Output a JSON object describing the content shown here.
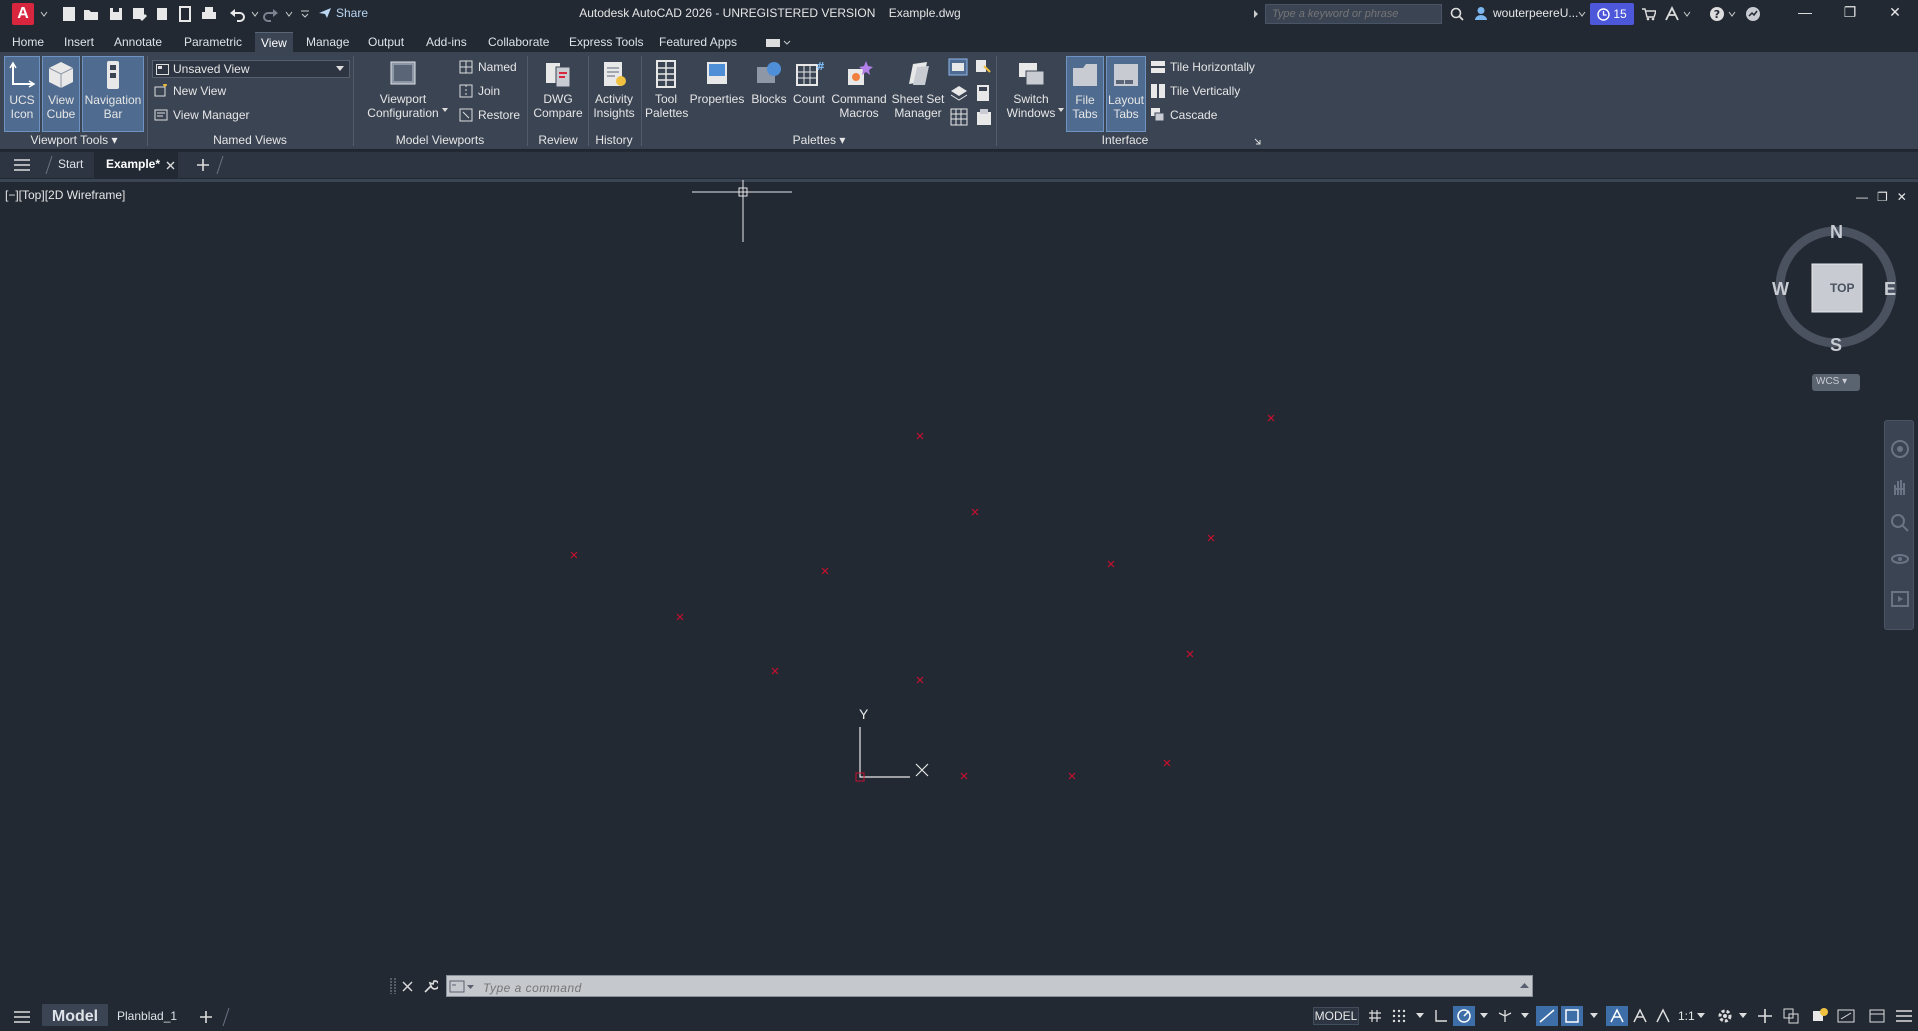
{
  "app": {
    "logo_letter": "A",
    "title": "Autodesk AutoCAD 2026 - UNREGISTERED VERSION    Example.dwg",
    "share_label": "Share",
    "search_placeholder": "Type a keyword or phrase",
    "user": "wouterpeereU...",
    "notification_count": "15"
  },
  "ribbon_tabs": [
    "Home",
    "Insert",
    "Annotate",
    "Parametric",
    "View",
    "Manage",
    "Output",
    "Add-ins",
    "Collaborate",
    "Express Tools",
    "Featured Apps"
  ],
  "active_tab": "View",
  "ribbon": {
    "viewport_tools": {
      "title": "Viewport Tools",
      "ucs_icon": "UCS Icon",
      "view_cube": "View Cube",
      "navigation_bar": "Navigation Bar"
    },
    "named_views": {
      "title": "Named Views",
      "combo_value": "Unsaved View",
      "new_view": "New View",
      "view_manager": "View Manager"
    },
    "model_viewports": {
      "title": "Model Viewports",
      "viewport_configuration": "Viewport Configuration",
      "named": "Named",
      "join": "Join",
      "restore": "Restore"
    },
    "review": {
      "title": "Review",
      "dwg_compare": "DWG Compare"
    },
    "history": {
      "title": "History",
      "activity_insights": "Activity Insights"
    },
    "palettes": {
      "title": "Palettes",
      "tool_palettes": "Tool Palettes",
      "properties": "Properties",
      "blocks": "Blocks",
      "count": "Count",
      "command_macros": "Command Macros",
      "sheet_set_manager": "Sheet Set Manager"
    },
    "interface": {
      "title": "Interface",
      "switch_windows": "Switch Windows",
      "file_tabs": "File Tabs",
      "layout_tabs": "Layout Tabs",
      "tile_horizontally": "Tile Horizontally",
      "tile_vertically": "Tile Vertically",
      "cascade": "Cascade"
    }
  },
  "file_tabs": {
    "start": "Start",
    "active": "Example*"
  },
  "viewport": {
    "label": "[−][Top][2D Wireframe]",
    "compass": {
      "n": "N",
      "s": "S",
      "e": "E",
      "w": "W",
      "face": "TOP"
    },
    "wcs": "WCS",
    "ucs_x": "X",
    "ucs_y": "Y"
  },
  "command_line": {
    "placeholder": "Type a command"
  },
  "layout_tabs": {
    "model": "Model",
    "layout1": "Planblad_1"
  },
  "status": {
    "model_space": "MODEL",
    "scale": "1:1"
  },
  "colors": {
    "background": "#222933",
    "ribbon": "#3b4453",
    "accent": "#4d57d9",
    "point_marker": "#c8102e"
  }
}
